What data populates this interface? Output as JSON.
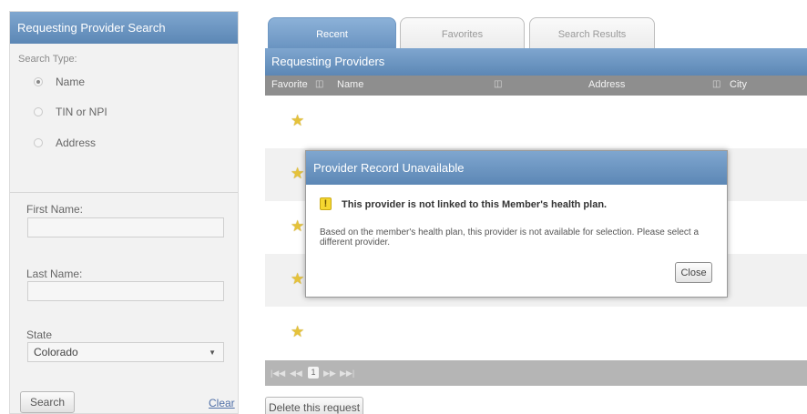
{
  "left_panel": {
    "title": "Requesting Provider Search",
    "search_type_label": "Search Type:",
    "search_types": [
      {
        "label": "Name",
        "checked": true
      },
      {
        "label": "TIN or NPI",
        "checked": false
      },
      {
        "label": "Address",
        "checked": false
      }
    ],
    "first_name_label": "First Name:",
    "first_name_value": "",
    "last_name_label": "Last Name:",
    "last_name_value": "",
    "state_label": "State",
    "state_value": "Colorado",
    "search_button": "Search",
    "clear_link": "Clear"
  },
  "tabs": [
    {
      "label": "Recent",
      "active": true
    },
    {
      "label": "Favorites",
      "active": false
    },
    {
      "label": "Search Results",
      "active": false
    }
  ],
  "grid": {
    "title": "Requesting Providers",
    "columns": [
      "Favorite",
      "Name",
      "Address",
      "City"
    ],
    "sort_icon": "column-sort-icon",
    "rows": [
      {
        "favorite": true
      },
      {
        "favorite": true
      },
      {
        "favorite": true
      },
      {
        "favorite": true
      },
      {
        "favorite": true
      }
    ]
  },
  "pager": {
    "first": "|◀◀",
    "prev": "◀◀",
    "page": "1",
    "next": "▶▶",
    "last": "▶▶|"
  },
  "delete_button": "Delete this request",
  "modal": {
    "title": "Provider Record Unavailable",
    "warning_icon": "!",
    "warning_text": "This provider is not linked to this Member's health plan.",
    "message": "Based on the member's health plan, this provider is not available for selection. Please select a different provider.",
    "close_button": "Close"
  },
  "colors": {
    "header_blue": "#6a94c1",
    "star_gold": "#e5c23a",
    "warning_yellow": "#f5d730",
    "link_blue": "#4f6fa7"
  }
}
